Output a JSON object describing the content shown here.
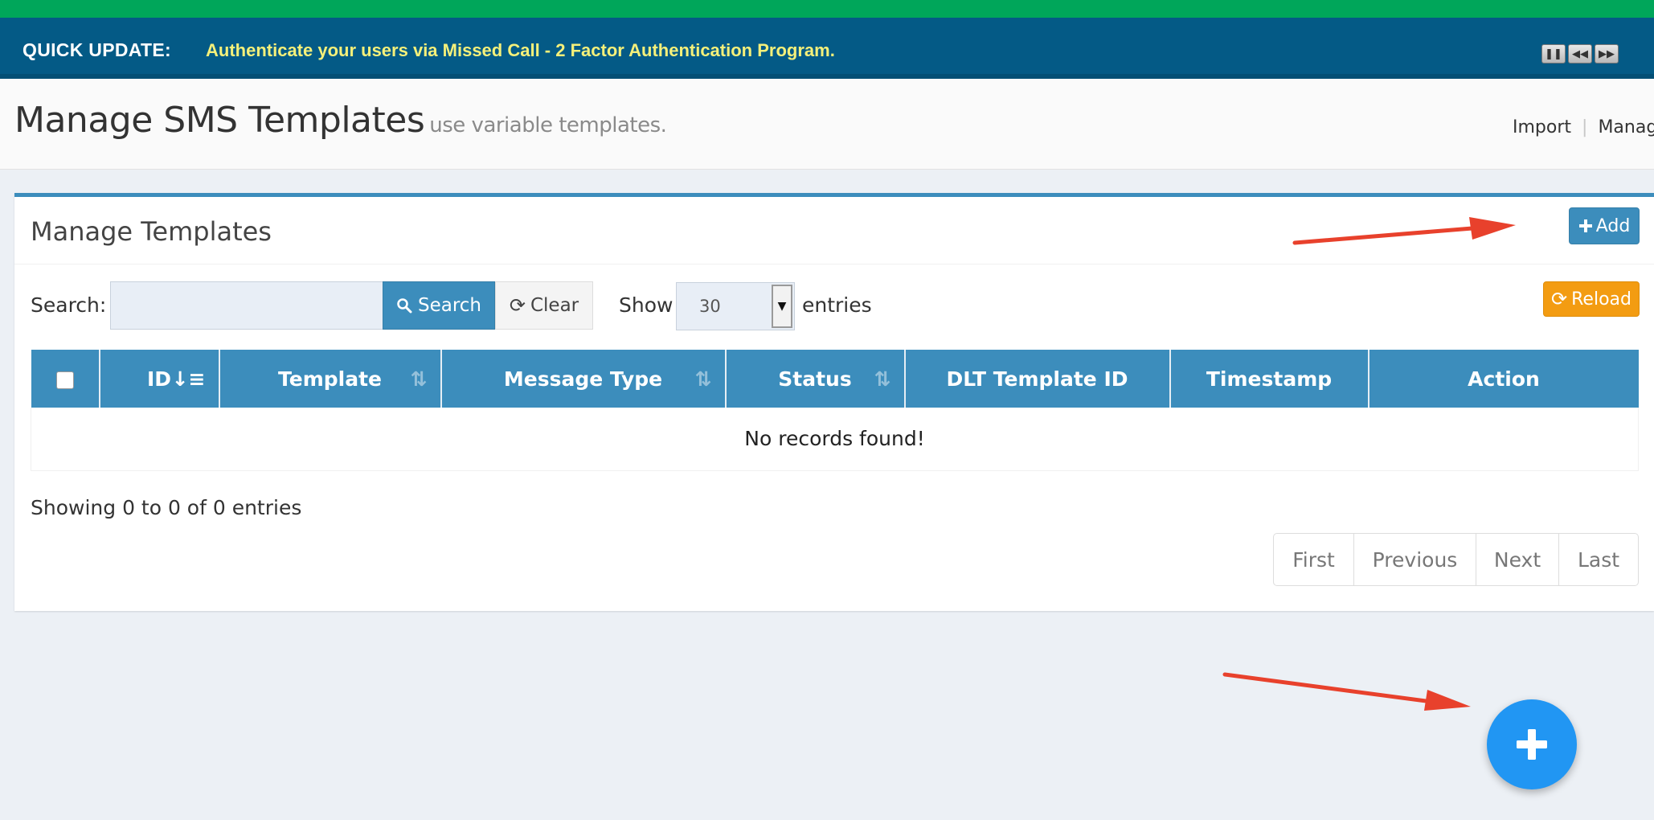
{
  "ticker": {
    "label": "QUICK UPDATE:",
    "message": "Authenticate your users via Missed Call - 2 Factor Authentication Program.",
    "controls": [
      {
        "name": "pause",
        "icon": "pause-icon"
      },
      {
        "name": "previous",
        "icon": "rewind-icon"
      },
      {
        "name": "next",
        "icon": "fast-forward-icon"
      }
    ]
  },
  "header": {
    "title": "Manage SMS Templates",
    "subtitle": "use variable templates.",
    "links": [
      "Import",
      "Manage"
    ]
  },
  "box": {
    "title": "Manage Templates",
    "add_label": "Add",
    "reload_label": "Reload"
  },
  "search": {
    "label": "Search:",
    "value": "",
    "placeholder": "",
    "search_label": "Search",
    "clear_label": "Clear"
  },
  "length": {
    "show_label": "Show",
    "value": "30",
    "entries_label": "entries"
  },
  "table": {
    "columns": [
      "",
      "ID",
      "Template",
      "Message Type",
      "Status",
      "DLT Template ID",
      "Timestamp",
      "Action"
    ],
    "empty_text": "No records found!"
  },
  "info": {
    "text": "Showing 0 to 0 of 0 entries"
  },
  "pagination": [
    "First",
    "Previous",
    "Next",
    "Last"
  ],
  "colors": {
    "primary": "#3c8dbc",
    "warning": "#f39c12",
    "success_strip": "#00a65a",
    "ticker_bg": "#045a86",
    "ticker_text": "#f5f07a",
    "fab": "#2196f3",
    "annotation_arrow": "#e8412c"
  },
  "icons": {
    "add": "plus-icon",
    "search": "search-icon",
    "clear": "refresh-icon",
    "reload": "refresh-icon",
    "fab": "plus-icon",
    "sort": "sort-icon",
    "dropdown": "caret-down-icon"
  }
}
